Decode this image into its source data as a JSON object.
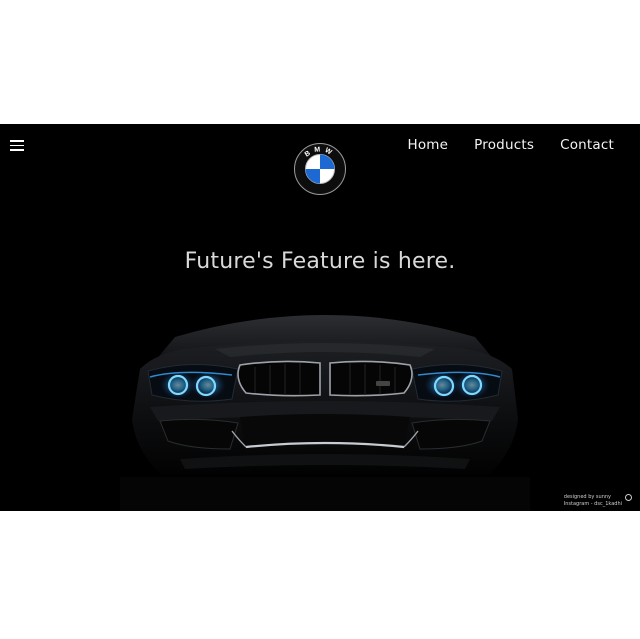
{
  "nav": {
    "items": [
      {
        "label": "Home"
      },
      {
        "label": "Products"
      },
      {
        "label": "Contact"
      }
    ]
  },
  "logo": {
    "text": "BMW"
  },
  "hero": {
    "headline": "Future's Feature is here."
  },
  "credit": {
    "line1": "designed by sunny",
    "line2": "Instagram - dsc_1kadhi"
  },
  "colors": {
    "background": "#000000",
    "page": "#ffffff",
    "headlight": "#39b9ff",
    "roundel_blue": "#1c69d4"
  }
}
